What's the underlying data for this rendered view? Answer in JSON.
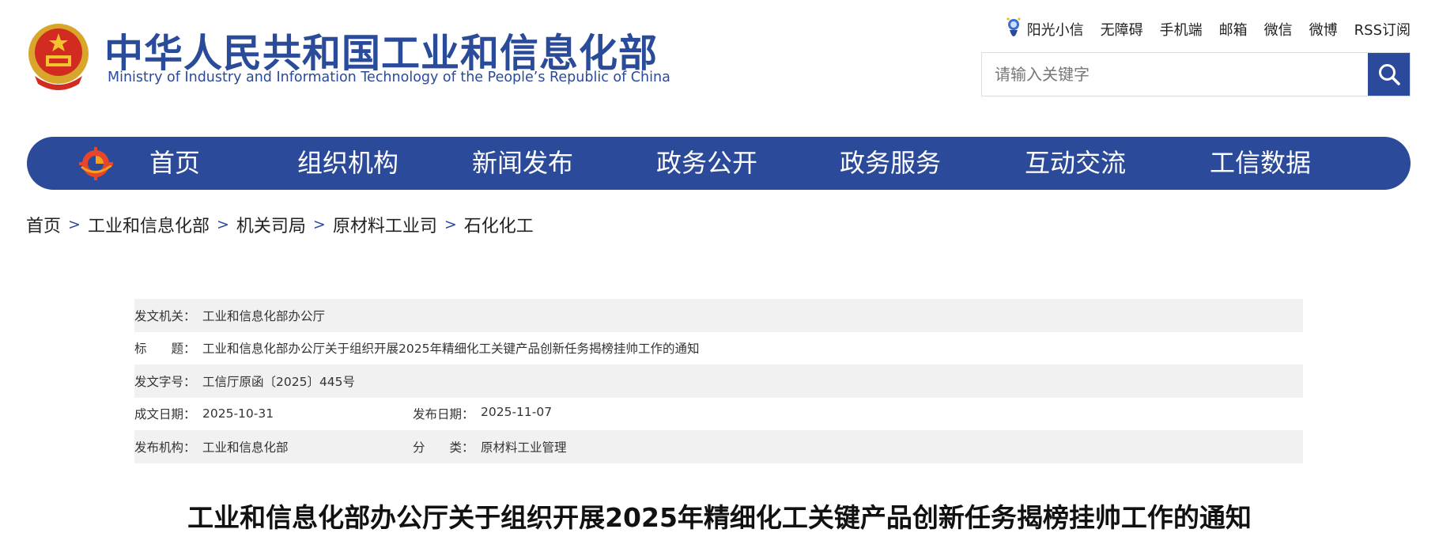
{
  "header": {
    "title_cn": "中华人民共和国工业和信息化部",
    "title_en": "Ministry of Industry and Information Technology of the People’s Republic of China",
    "emblem_icon": "national-emblem-icon",
    "top_links": [
      "阳光小信",
      "无障碍",
      "手机端",
      "邮箱",
      "微信",
      "微博",
      "RSS订阅"
    ],
    "search": {
      "placeholder": "请输入关键字",
      "value": ""
    }
  },
  "nav": {
    "logo_icon": "miit-logo-icon",
    "items": [
      "首页",
      "组织机构",
      "新闻发布",
      "政务公开",
      "政务服务",
      "互动交流",
      "工信数据"
    ],
    "color": "#2c4a9a"
  },
  "breadcrumb": [
    "首页",
    "工业和信息化部",
    "机关司局",
    "原材料工业司",
    "石化化工"
  ],
  "meta": {
    "issuer_label": "发文机关：",
    "issuer": "工业和信息化部办公厅",
    "title_label": "标　　题：",
    "title": "工业和信息化部办公厅关于组织开展2025年精细化工关键产品创新任务揭榜挂帅工作的通知",
    "docno_label": "发文字号：",
    "docno": "工信厅原函〔2025〕445号",
    "written_label": "成文日期：",
    "written": "2025-10-31",
    "published_label": "发布日期：",
    "published": "2025-11-07",
    "org_label": "发布机构：",
    "org": "工业和信息化部",
    "category_label": "分　　类：",
    "category": "原材料工业管理"
  },
  "doc_title": "工业和信息化部办公厅关于组织开展2025年精细化工关键产品创新任务揭榜挂帅工作的通知"
}
